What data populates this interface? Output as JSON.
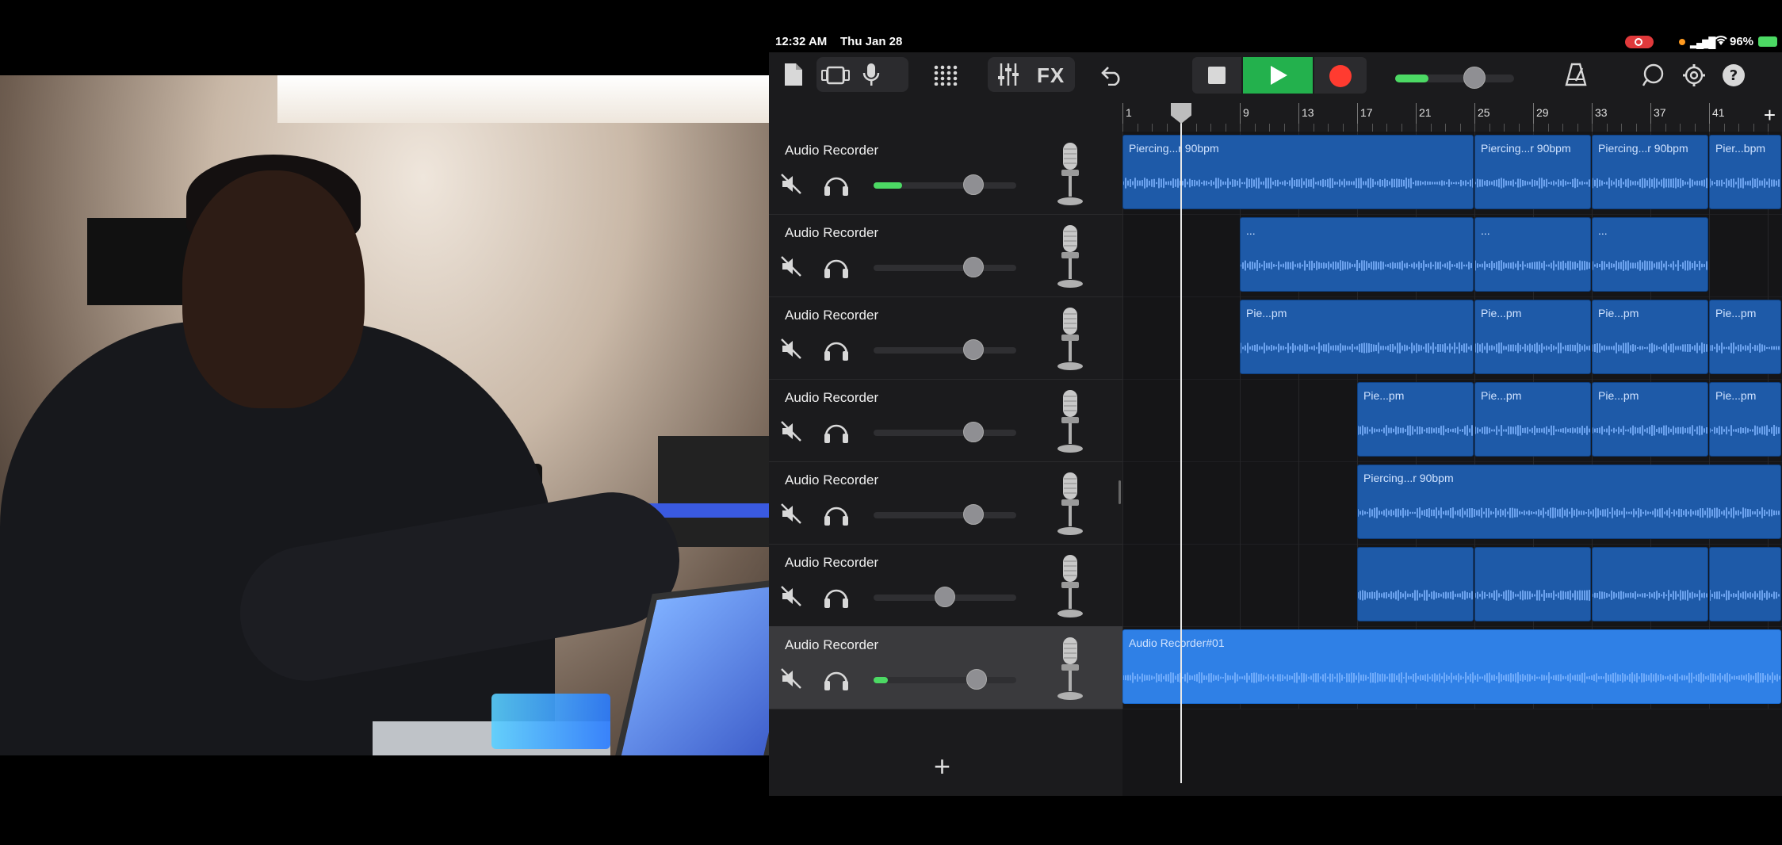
{
  "status": {
    "time": "12:32 AM",
    "date": "Thu Jan 28",
    "battery": "96%"
  },
  "toolbar": {
    "fx_label": "FX"
  },
  "ruler": {
    "bars": [
      "1",
      "5",
      "9",
      "13",
      "17",
      "21",
      "25",
      "29",
      "33",
      "37",
      "41"
    ]
  },
  "tracks": [
    {
      "name": "Audio Recorder",
      "volume": 0.7,
      "level": 0.2,
      "selected": false
    },
    {
      "name": "Audio Recorder",
      "volume": 0.7,
      "level": 0,
      "selected": false
    },
    {
      "name": "Audio Recorder",
      "volume": 0.7,
      "level": 0,
      "selected": false
    },
    {
      "name": "Audio Recorder",
      "volume": 0.7,
      "level": 0,
      "selected": false
    },
    {
      "name": "Audio Recorder",
      "volume": 0.7,
      "level": 0,
      "selected": false
    },
    {
      "name": "Audio Recorder",
      "volume": 0.5,
      "level": 0,
      "selected": false
    },
    {
      "name": "Audio Recorder",
      "volume": 0.72,
      "level": 0.1,
      "selected": true
    }
  ],
  "regions": [
    [
      {
        "label": "Piercing...r 90bpm",
        "start": 1,
        "end": 25
      },
      {
        "label": "Piercing...r 90bpm",
        "start": 25,
        "end": 33
      },
      {
        "label": "Piercing...r 90bpm",
        "start": 33,
        "end": 41
      },
      {
        "label": "Pier...bpm",
        "start": 41,
        "end": 46
      }
    ],
    [
      {
        "label": "...",
        "start": 9,
        "end": 25
      },
      {
        "label": "...",
        "start": 25,
        "end": 33
      },
      {
        "label": "...",
        "start": 33,
        "end": 41
      }
    ],
    [
      {
        "label": "Pie...pm",
        "start": 9,
        "end": 25
      },
      {
        "label": "Pie...pm",
        "start": 25,
        "end": 33
      },
      {
        "label": "Pie...pm",
        "start": 33,
        "end": 41
      },
      {
        "label": "Pie...pm",
        "start": 41,
        "end": 46
      }
    ],
    [
      {
        "label": "Pie...pm",
        "start": 17,
        "end": 25
      },
      {
        "label": "Pie...pm",
        "start": 25,
        "end": 33
      },
      {
        "label": "Pie...pm",
        "start": 33,
        "end": 41
      },
      {
        "label": "Pie...pm",
        "start": 41,
        "end": 46
      }
    ],
    [
      {
        "label": "Piercing...r 90bpm",
        "start": 17,
        "end": 46.2
      }
    ],
    [
      {
        "label": "",
        "start": 17,
        "end": 25
      },
      {
        "label": "",
        "start": 25,
        "end": 33
      },
      {
        "label": "",
        "start": 33,
        "end": 41
      },
      {
        "label": "",
        "start": 41,
        "end": 46
      }
    ],
    [
      {
        "label": "Audio Recorder#01",
        "start": 1,
        "end": 46.2,
        "highlight": true
      }
    ]
  ],
  "add_track_label": "+",
  "colors": {
    "record": "#e0393b",
    "play": "#23b14d",
    "region": "#1e5aa8",
    "region_selected": "#2f80e6",
    "meter": "#4cd964"
  }
}
